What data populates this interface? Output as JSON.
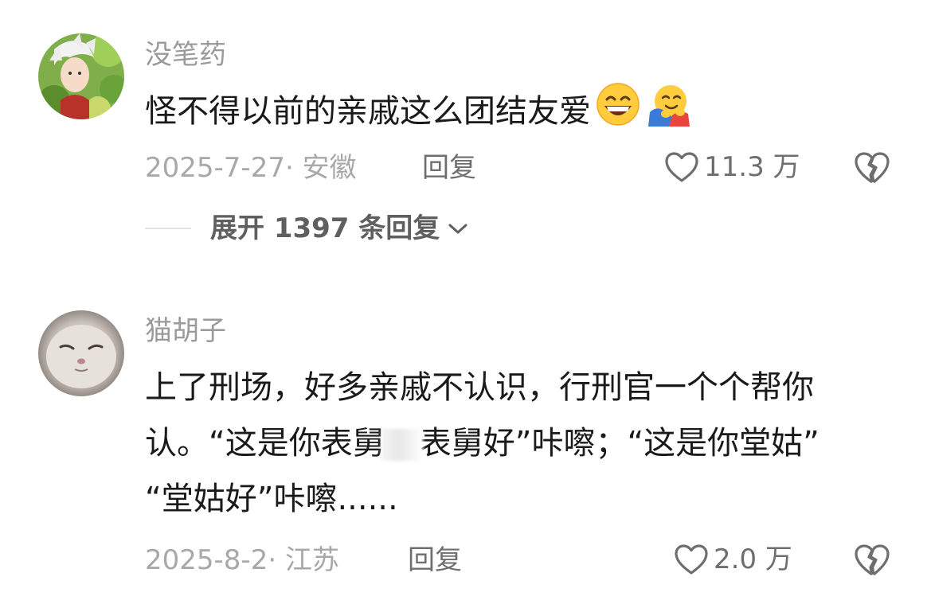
{
  "comments": [
    {
      "username": "没笔药",
      "text": "怪不得以前的亲戚这么团结友爱",
      "emojis": [
        "grinning-face-icon",
        "hugging-face-icon"
      ],
      "date_location": "2025-7-27· 安徽",
      "reply_label": "回复",
      "likes": "11.3 万",
      "expand_replies": "展开 1397 条回复"
    },
    {
      "username": "猫胡子",
      "text_lines": [
        "上了刑场，好多亲戚不认识，行刑官一个个帮你",
        "认。“这是你表舅",
        "表舅好”咔嚓；“这是你堂姑”",
        "“堂姑好”咔嚓......"
      ],
      "date_location": "2025-8-2· 江苏",
      "reply_label": "回复",
      "likes": "2.0 万"
    }
  ],
  "colors": {
    "username": "#9a9a9a",
    "content": "#1a1a1a",
    "meta": "#a8a8a8",
    "action": "#6e6e6e"
  }
}
